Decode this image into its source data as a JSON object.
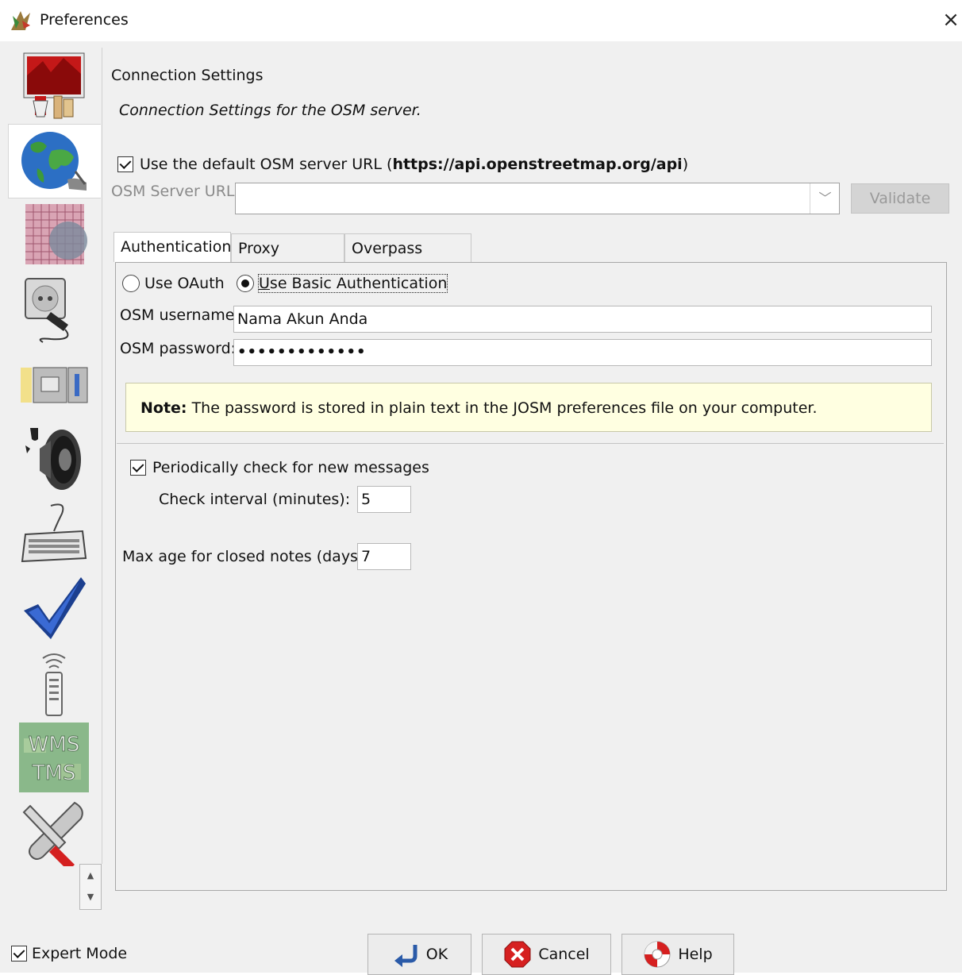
{
  "window": {
    "title": "Preferences",
    "close_symbol": "×"
  },
  "sidebar": {
    "items": [
      {
        "name": "display-settings",
        "icon": "paint-brush-icon"
      },
      {
        "name": "connection-settings",
        "icon": "globe-icon",
        "active": true
      },
      {
        "name": "map-projection",
        "icon": "grid-map-icon"
      },
      {
        "name": "remote-control-plug",
        "icon": "power-plug-icon"
      },
      {
        "name": "file-settings",
        "icon": "folders-icon"
      },
      {
        "name": "audio-settings",
        "icon": "speaker-icon"
      },
      {
        "name": "keyboard-shortcuts",
        "icon": "keyboard-icon"
      },
      {
        "name": "validator",
        "icon": "checkmark-icon"
      },
      {
        "name": "remote-control",
        "icon": "remote-icon"
      },
      {
        "name": "imagery",
        "icon": "wms-tms-icon",
        "label1": "WMS",
        "label2": "TMS"
      },
      {
        "name": "advanced",
        "icon": "tools-icon"
      }
    ]
  },
  "content": {
    "title": "Connection Settings",
    "subtitle": "Connection Settings for the OSM server.",
    "default_url_prefix": "Use the default OSM server URL (",
    "default_url": "https://api.openstreetmap.org/api",
    "default_url_suffix": ")",
    "server_url_label": "OSM Server URL:",
    "server_url_value": "",
    "validate_label": "Validate"
  },
  "tabs": [
    {
      "label": "Authentication",
      "active": true
    },
    {
      "label": "Proxy settings"
    },
    {
      "label": "Overpass server"
    }
  ],
  "auth": {
    "oauth_label": "Use OAuth",
    "basic_prefix": "U",
    "basic_rest": "se Basic Authentication",
    "username_label": "OSM username:",
    "username_value": "Nama Akun Anda",
    "password_label": "OSM password:",
    "password_value": "•••••••••••••",
    "note_bold": "Note:",
    "note_text": " The password is stored in plain text in the JOSM preferences file on your computer."
  },
  "messages": {
    "periodic_label": "Periodically check for new messages",
    "interval_label": "Check interval (minutes):",
    "interval_value": "5",
    "max_age_label": "Max age for closed notes (days):",
    "max_age_value": "7"
  },
  "footer": {
    "expert_mode_label": "Expert Mode",
    "ok_label": "OK",
    "cancel_label": "Cancel",
    "help_label": "Help"
  },
  "colors": {
    "note_bg": "#ffffe1",
    "window_bg": "#f0f0f0",
    "cancel_red": "#d62020",
    "validate_disabled": "#d4d4d4"
  }
}
